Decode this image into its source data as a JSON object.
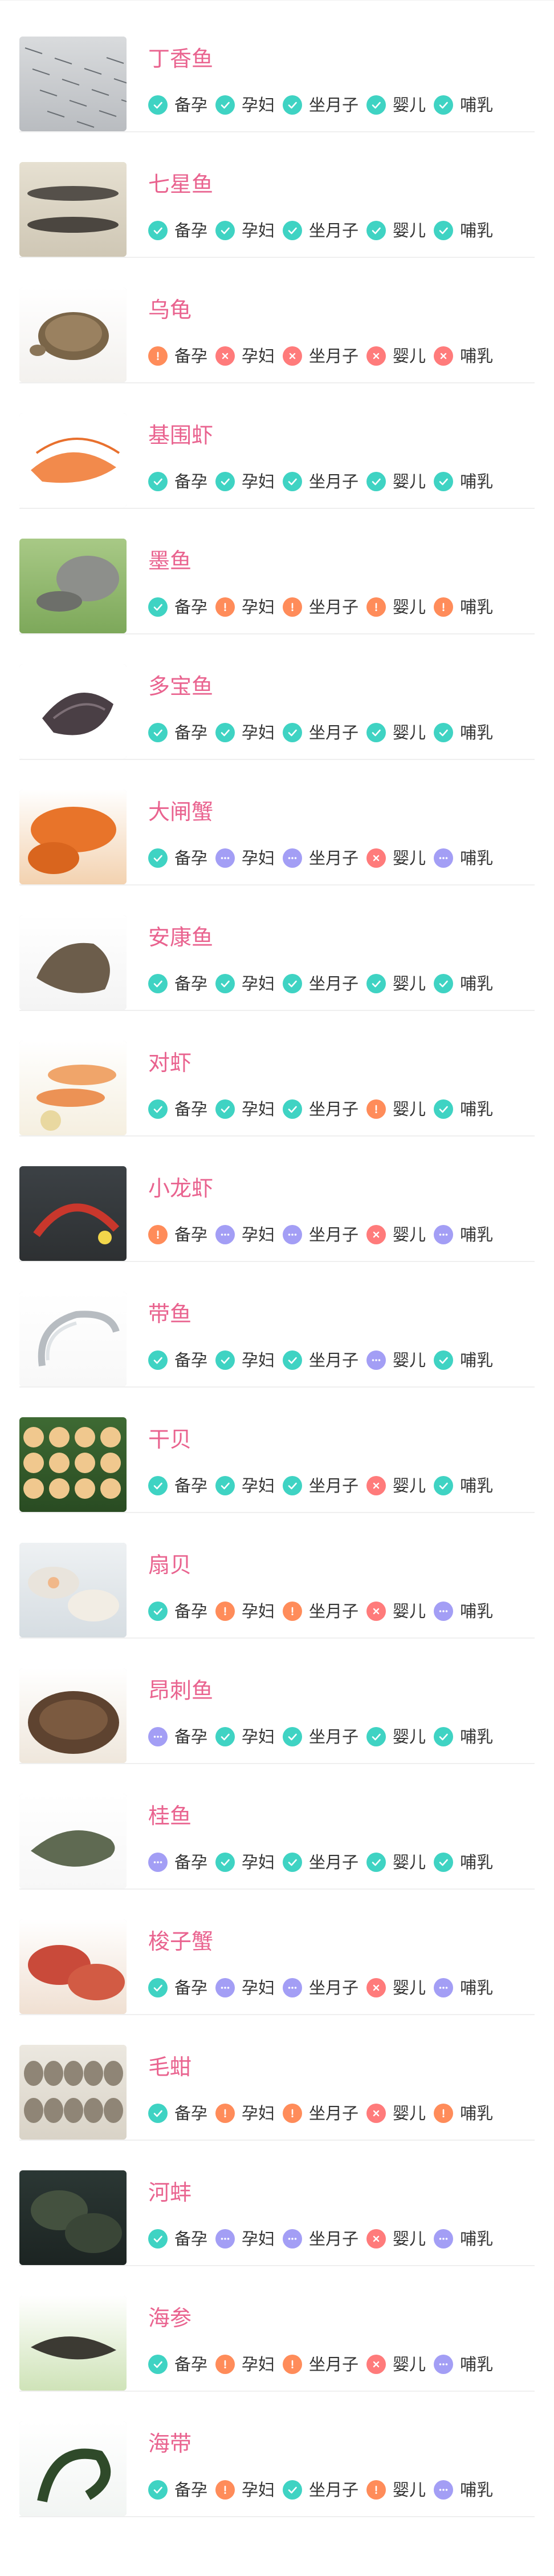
{
  "colors": {
    "name": "#e9638f",
    "ok": "#3fd3c3",
    "caution": "#ff8c5a",
    "no": "#ff7b7b",
    "unknown": "#a39ef5",
    "label": "#333333"
  },
  "status_icons": {
    "ok": "check-icon",
    "caution": "exclamation-icon",
    "no": "cross-icon",
    "unknown": "ellipsis-icon"
  },
  "foods": [
    {
      "name": "丁香鱼",
      "image_icon": "anchovy-fish-photo",
      "tags": [
        {
          "label": "备孕",
          "status": "ok"
        },
        {
          "label": "孕妇",
          "status": "ok"
        },
        {
          "label": "坐月子",
          "status": "ok"
        },
        {
          "label": "婴儿",
          "status": "ok"
        },
        {
          "label": "哺乳",
          "status": "ok"
        }
      ]
    },
    {
      "name": "七星鱼",
      "image_icon": "snakehead-fish-photo",
      "tags": [
        {
          "label": "备孕",
          "status": "ok"
        },
        {
          "label": "孕妇",
          "status": "ok"
        },
        {
          "label": "坐月子",
          "status": "ok"
        },
        {
          "label": "婴儿",
          "status": "ok"
        },
        {
          "label": "哺乳",
          "status": "ok"
        }
      ]
    },
    {
      "name": "乌龟",
      "image_icon": "tortoise-photo",
      "tags": [
        {
          "label": "备孕",
          "status": "caution"
        },
        {
          "label": "孕妇",
          "status": "no"
        },
        {
          "label": "坐月子",
          "status": "no"
        },
        {
          "label": "婴儿",
          "status": "no"
        },
        {
          "label": "哺乳",
          "status": "no"
        }
      ]
    },
    {
      "name": "基围虾",
      "image_icon": "shrimp-photo",
      "tags": [
        {
          "label": "备孕",
          "status": "ok"
        },
        {
          "label": "孕妇",
          "status": "ok"
        },
        {
          "label": "坐月子",
          "status": "ok"
        },
        {
          "label": "婴儿",
          "status": "ok"
        },
        {
          "label": "哺乳",
          "status": "ok"
        }
      ]
    },
    {
      "name": "墨鱼",
      "image_icon": "cuttlefish-photo",
      "tags": [
        {
          "label": "备孕",
          "status": "ok"
        },
        {
          "label": "孕妇",
          "status": "caution"
        },
        {
          "label": "坐月子",
          "status": "caution"
        },
        {
          "label": "婴儿",
          "status": "caution"
        },
        {
          "label": "哺乳",
          "status": "caution"
        }
      ]
    },
    {
      "name": "多宝鱼",
      "image_icon": "turbot-photo",
      "tags": [
        {
          "label": "备孕",
          "status": "ok"
        },
        {
          "label": "孕妇",
          "status": "ok"
        },
        {
          "label": "坐月子",
          "status": "ok"
        },
        {
          "label": "婴儿",
          "status": "ok"
        },
        {
          "label": "哺乳",
          "status": "ok"
        }
      ]
    },
    {
      "name": "大闸蟹",
      "image_icon": "hairy-crab-photo",
      "tags": [
        {
          "label": "备孕",
          "status": "ok"
        },
        {
          "label": "孕妇",
          "status": "unknown"
        },
        {
          "label": "坐月子",
          "status": "unknown"
        },
        {
          "label": "婴儿",
          "status": "no"
        },
        {
          "label": "哺乳",
          "status": "unknown"
        }
      ]
    },
    {
      "name": "安康鱼",
      "image_icon": "monkfish-photo",
      "tags": [
        {
          "label": "备孕",
          "status": "ok"
        },
        {
          "label": "孕妇",
          "status": "ok"
        },
        {
          "label": "坐月子",
          "status": "ok"
        },
        {
          "label": "婴儿",
          "status": "ok"
        },
        {
          "label": "哺乳",
          "status": "ok"
        }
      ]
    },
    {
      "name": "对虾",
      "image_icon": "prawn-photo",
      "tags": [
        {
          "label": "备孕",
          "status": "ok"
        },
        {
          "label": "孕妇",
          "status": "ok"
        },
        {
          "label": "坐月子",
          "status": "ok"
        },
        {
          "label": "婴儿",
          "status": "caution"
        },
        {
          "label": "哺乳",
          "status": "ok"
        }
      ]
    },
    {
      "name": "小龙虾",
      "image_icon": "crayfish-photo",
      "tags": [
        {
          "label": "备孕",
          "status": "caution"
        },
        {
          "label": "孕妇",
          "status": "unknown"
        },
        {
          "label": "坐月子",
          "status": "unknown"
        },
        {
          "label": "婴儿",
          "status": "no"
        },
        {
          "label": "哺乳",
          "status": "unknown"
        }
      ]
    },
    {
      "name": "带鱼",
      "image_icon": "hairtail-photo",
      "tags": [
        {
          "label": "备孕",
          "status": "ok"
        },
        {
          "label": "孕妇",
          "status": "ok"
        },
        {
          "label": "坐月子",
          "status": "ok"
        },
        {
          "label": "婴儿",
          "status": "unknown"
        },
        {
          "label": "哺乳",
          "status": "ok"
        }
      ]
    },
    {
      "name": "干贝",
      "image_icon": "dried-scallop-photo",
      "tags": [
        {
          "label": "备孕",
          "status": "ok"
        },
        {
          "label": "孕妇",
          "status": "ok"
        },
        {
          "label": "坐月子",
          "status": "ok"
        },
        {
          "label": "婴儿",
          "status": "no"
        },
        {
          "label": "哺乳",
          "status": "ok"
        }
      ]
    },
    {
      "name": "扇贝",
      "image_icon": "scallop-photo",
      "tags": [
        {
          "label": "备孕",
          "status": "ok"
        },
        {
          "label": "孕妇",
          "status": "caution"
        },
        {
          "label": "坐月子",
          "status": "caution"
        },
        {
          "label": "婴儿",
          "status": "no"
        },
        {
          "label": "哺乳",
          "status": "unknown"
        }
      ]
    },
    {
      "name": "昂刺鱼",
      "image_icon": "yellow-catfish-photo",
      "tags": [
        {
          "label": "备孕",
          "status": "unknown"
        },
        {
          "label": "孕妇",
          "status": "ok"
        },
        {
          "label": "坐月子",
          "status": "ok"
        },
        {
          "label": "婴儿",
          "status": "ok"
        },
        {
          "label": "哺乳",
          "status": "ok"
        }
      ]
    },
    {
      "name": "桂鱼",
      "image_icon": "mandarin-fish-photo",
      "tags": [
        {
          "label": "备孕",
          "status": "unknown"
        },
        {
          "label": "孕妇",
          "status": "ok"
        },
        {
          "label": "坐月子",
          "status": "ok"
        },
        {
          "label": "婴儿",
          "status": "ok"
        },
        {
          "label": "哺乳",
          "status": "ok"
        }
      ]
    },
    {
      "name": "梭子蟹",
      "image_icon": "swimming-crab-photo",
      "tags": [
        {
          "label": "备孕",
          "status": "ok"
        },
        {
          "label": "孕妇",
          "status": "unknown"
        },
        {
          "label": "坐月子",
          "status": "unknown"
        },
        {
          "label": "婴儿",
          "status": "no"
        },
        {
          "label": "哺乳",
          "status": "unknown"
        }
      ]
    },
    {
      "name": "毛蚶",
      "image_icon": "ark-clam-photo",
      "tags": [
        {
          "label": "备孕",
          "status": "ok"
        },
        {
          "label": "孕妇",
          "status": "caution"
        },
        {
          "label": "坐月子",
          "status": "caution"
        },
        {
          "label": "婴儿",
          "status": "no"
        },
        {
          "label": "哺乳",
          "status": "caution"
        }
      ]
    },
    {
      "name": "河蚌",
      "image_icon": "river-mussel-photo",
      "tags": [
        {
          "label": "备孕",
          "status": "ok"
        },
        {
          "label": "孕妇",
          "status": "unknown"
        },
        {
          "label": "坐月子",
          "status": "unknown"
        },
        {
          "label": "婴儿",
          "status": "no"
        },
        {
          "label": "哺乳",
          "status": "unknown"
        }
      ]
    },
    {
      "name": "海参",
      "image_icon": "sea-cucumber-photo",
      "tags": [
        {
          "label": "备孕",
          "status": "ok"
        },
        {
          "label": "孕妇",
          "status": "caution"
        },
        {
          "label": "坐月子",
          "status": "caution"
        },
        {
          "label": "婴儿",
          "status": "no"
        },
        {
          "label": "哺乳",
          "status": "unknown"
        }
      ]
    },
    {
      "name": "海带",
      "image_icon": "kelp-photo",
      "tags": [
        {
          "label": "备孕",
          "status": "ok"
        },
        {
          "label": "孕妇",
          "status": "caution"
        },
        {
          "label": "坐月子",
          "status": "ok"
        },
        {
          "label": "婴儿",
          "status": "caution"
        },
        {
          "label": "哺乳",
          "status": "unknown"
        }
      ]
    }
  ]
}
